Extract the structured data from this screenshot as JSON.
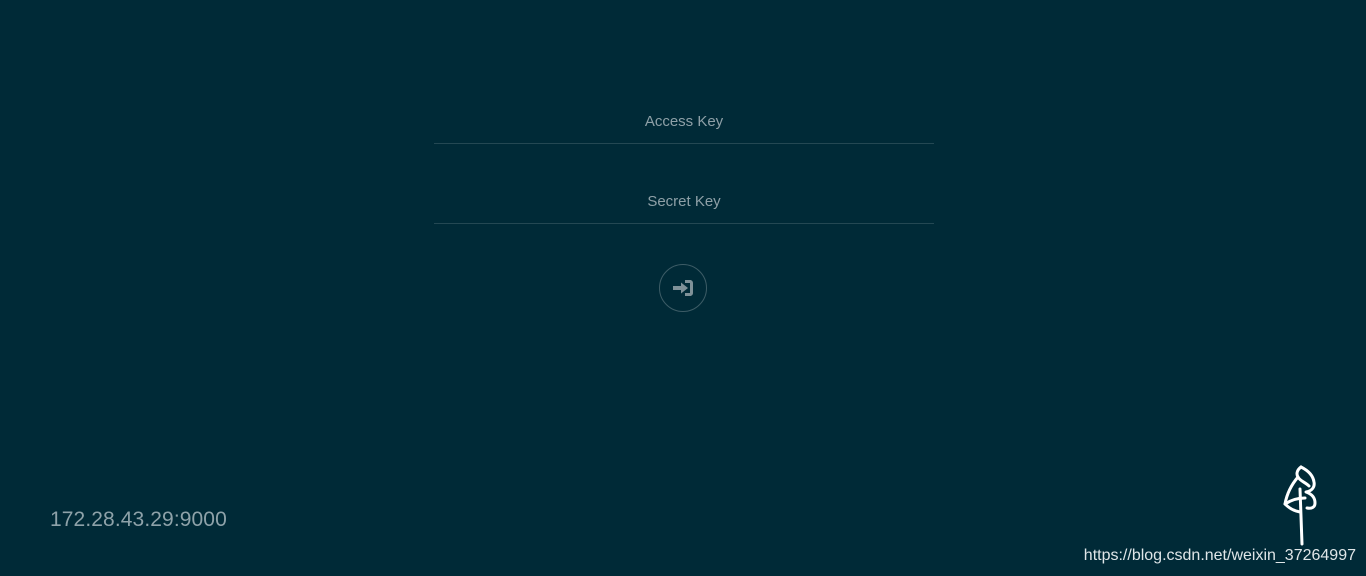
{
  "login": {
    "access_key": {
      "placeholder": "Access Key",
      "value": ""
    },
    "secret_key": {
      "placeholder": "Secret Key",
      "value": ""
    }
  },
  "footer": {
    "server_address": "172.28.43.29:9000",
    "watermark": "https://blog.csdn.net/weixin_37264997"
  },
  "icons": {
    "submit": "sign-in-icon",
    "logo": "minio-logo-icon"
  },
  "colors": {
    "background": "#002a37",
    "placeholder": "#8ea0a7",
    "server_address": "#8ea2a9",
    "icon": "#7f9198",
    "logo": "#ffffff",
    "watermark": "#dfe6e8"
  }
}
